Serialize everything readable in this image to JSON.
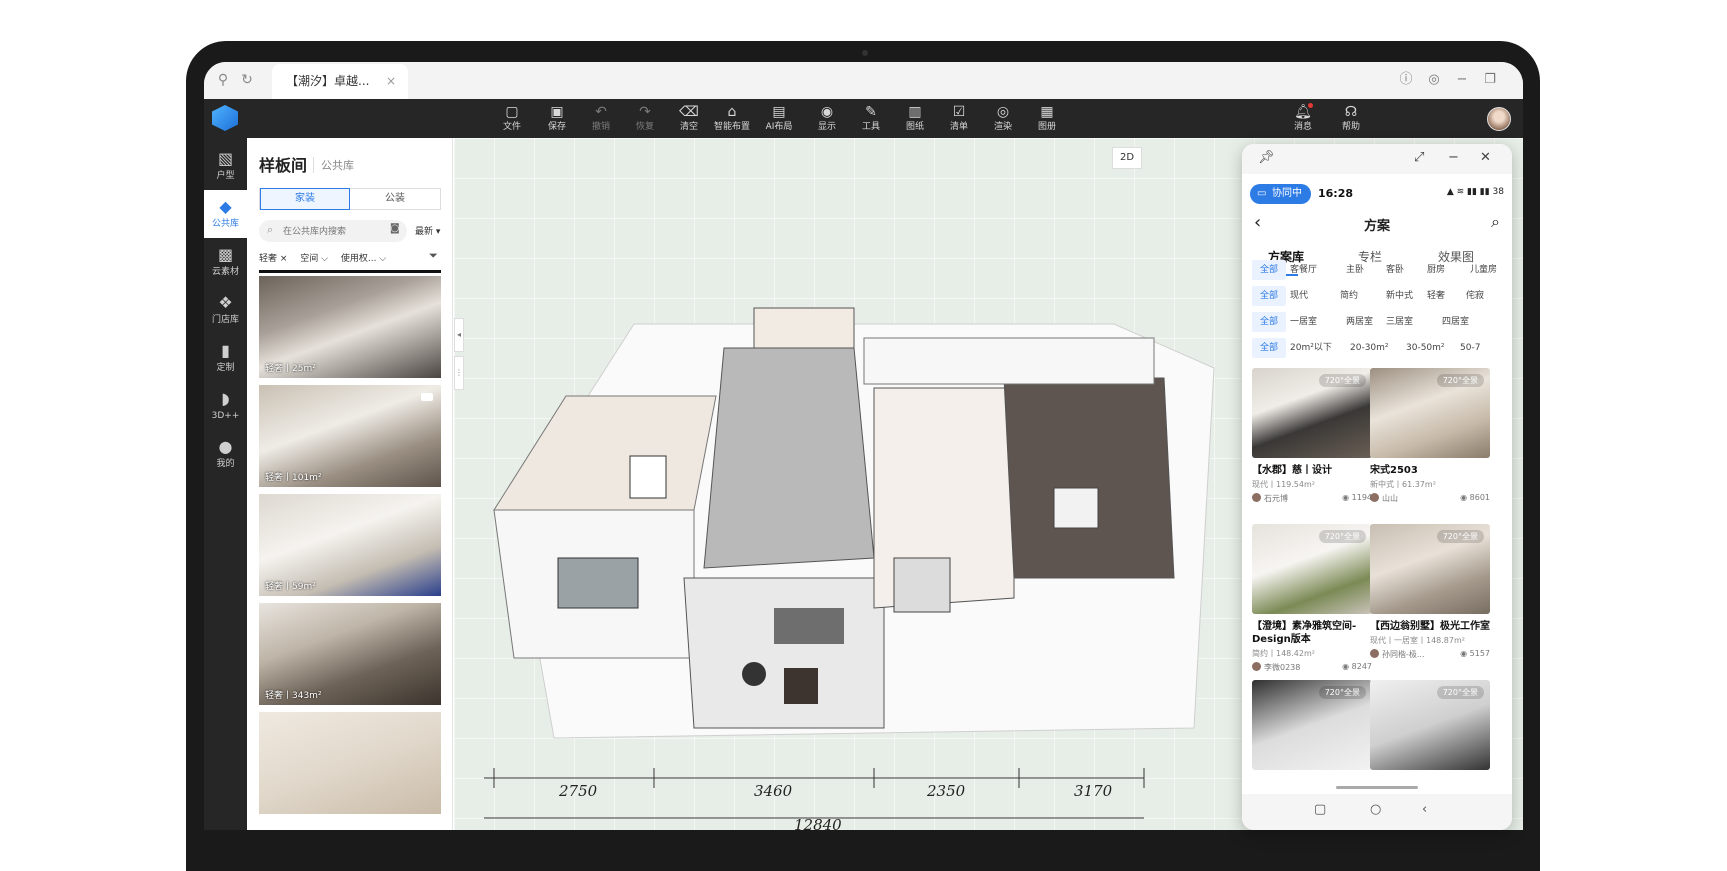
{
  "browser": {
    "tab_title": "【潮汐】卓越...",
    "close": "×"
  },
  "toolbar": {
    "tools": [
      {
        "label": "文件",
        "icon": "file-icon",
        "glyph": "▢"
      },
      {
        "label": "保存",
        "icon": "save-icon",
        "glyph": "▣"
      },
      {
        "label": "撤销",
        "icon": "undo-icon",
        "glyph": "↶"
      },
      {
        "label": "恢复",
        "icon": "redo-icon",
        "glyph": "↷"
      },
      {
        "label": "清空",
        "icon": "clear-icon",
        "glyph": "⌫"
      },
      {
        "label": "智能布置",
        "icon": "smart-layout-icon",
        "glyph": "⌂"
      },
      {
        "label": "AI布局",
        "icon": "ai-layout-icon",
        "glyph": "▤"
      },
      {
        "label": "显示",
        "icon": "display-icon",
        "glyph": "◉"
      },
      {
        "label": "工具",
        "icon": "wrench-icon",
        "glyph": "✎"
      },
      {
        "label": "图纸",
        "icon": "drawing-icon",
        "glyph": "▥"
      },
      {
        "label": "清单",
        "icon": "checklist-icon",
        "glyph": "☑"
      },
      {
        "label": "渲染",
        "icon": "render-icon",
        "glyph": "◎"
      },
      {
        "label": "图册",
        "icon": "album-icon",
        "glyph": "▦"
      }
    ],
    "message": "消息",
    "help": "帮助"
  },
  "rail": [
    {
      "label": "户型",
      "icon": "floorplan-icon",
      "glyph": "▧"
    },
    {
      "label": "公共库",
      "icon": "library-icon",
      "glyph": "◆"
    },
    {
      "label": "云素材",
      "icon": "cloud-material-icon",
      "glyph": "▩"
    },
    {
      "label": "门店库",
      "icon": "store-icon",
      "glyph": "❖"
    },
    {
      "label": "定制",
      "icon": "custom-icon",
      "glyph": "▮"
    },
    {
      "label": "3D++",
      "icon": "3d-icon",
      "glyph": "◗"
    },
    {
      "label": "我的",
      "icon": "user-icon",
      "glyph": "●"
    }
  ],
  "panel": {
    "title": "样板间",
    "subtitle": "公共库",
    "seg": [
      "家装",
      "公装"
    ],
    "search_placeholder": "在公共库内搜索",
    "sort": "最新 ▾",
    "filters": [
      "轻奢 ×",
      "空间 ⌵",
      "使用权... ⌵"
    ],
    "cards": [
      {
        "caption": "轻奢丨25m²",
        "bg": "linear-gradient(160deg,#6b6259 0%,#a8a098 35%,#e6e1da 55%,#4a4541 100%)",
        "video": false
      },
      {
        "caption": "轻奢丨101m²",
        "bg": "linear-gradient(160deg,#c9c0b3 0%,#efece6 40%,#9a8f82 70%,#5e544a 100%)",
        "video": true
      },
      {
        "caption": "轻奢丨59m²",
        "bg": "linear-gradient(160deg,#ddd8d0 0%,#f5f3ef 40%,#c4bdb2 70%,#2a3f8c 100%)",
        "video": false
      },
      {
        "caption": "轻奢丨343m²",
        "bg": "linear-gradient(160deg,#e8e4de 0%,#bfb5a8 35%,#6e6358 65%,#3b342d 100%)",
        "video": false
      },
      {
        "caption": "",
        "bg": "linear-gradient(160deg,#efe9e0 0%,#e1d8cb 50%,#c9bba8 100%)",
        "video": false
      }
    ]
  },
  "canvas": {
    "view_2d": "2D",
    "dimensions": [
      "2750",
      "3460",
      "2350",
      "3170",
      "12840"
    ]
  },
  "phone": {
    "collab": "协同中",
    "time": "16:28",
    "signal": "▲ ≋ ▮▮ ▮▮ 38",
    "title": "方案",
    "tabs": [
      "方案库",
      "专栏",
      "效果图"
    ],
    "filter_rows": [
      [
        "全部",
        "客餐厅",
        "主卧",
        "客卧",
        "厨房",
        "儿童房"
      ],
      [
        "全部",
        "现代",
        "简约",
        "新中式",
        "轻奢",
        "侘寂"
      ],
      [
        "全部",
        "一居室",
        "两居室",
        "三居室",
        "四居室"
      ],
      [
        "全部",
        "20m²以下",
        "20-30m²",
        "30-50m²",
        "50-7"
      ]
    ],
    "badge": "720°全景",
    "projects": [
      {
        "name": "【水郡】慈丨设计",
        "meta": "现代丨119.54m²",
        "author": "石元博",
        "views": "1194",
        "bg": "linear-gradient(160deg,#d8d3cc 0%,#f0ede8 35%,#3a3836 60%,#6a5f55 100%)"
      },
      {
        "name": "宋式2503",
        "meta": "新中式丨61.37m²",
        "author": "山山",
        "views": "8601",
        "bg": "linear-gradient(160deg,#9c8f80 0%,#e9e3da 40%,#c6b9a8 70%,#8a7b6a 100%)"
      },
      {
        "name": "【澄境】素净雅筑空间-Design版本",
        "meta": "简约丨148.42m²",
        "author": "李微0238",
        "views": "8247",
        "bg": "linear-gradient(160deg,#e6e2dc 0%,#f7f5f2 40%,#7b8a55 72%,#c9c3ba 100%)"
      },
      {
        "name": "【西边翁别墅】极光工作室",
        "meta": "现代丨一居室丨148.87m²",
        "author": "孙同楷-极...",
        "views": "5157",
        "bg": "linear-gradient(160deg,#c8beb2 0%,#e8e1d8 40%,#a59a8c 70%,#786d61 100%)"
      },
      {
        "name": "",
        "meta": "",
        "author": "",
        "views": "",
        "bg": "linear-gradient(160deg,#2f2f2f 0%,#dcdcdc 50%,#f2f2f2 100%)"
      },
      {
        "name": "",
        "meta": "",
        "author": "",
        "views": "",
        "bg": "linear-gradient(160deg,#f0f0f0 0%,#cfcfcf 50%,#333 100%)"
      }
    ]
  }
}
